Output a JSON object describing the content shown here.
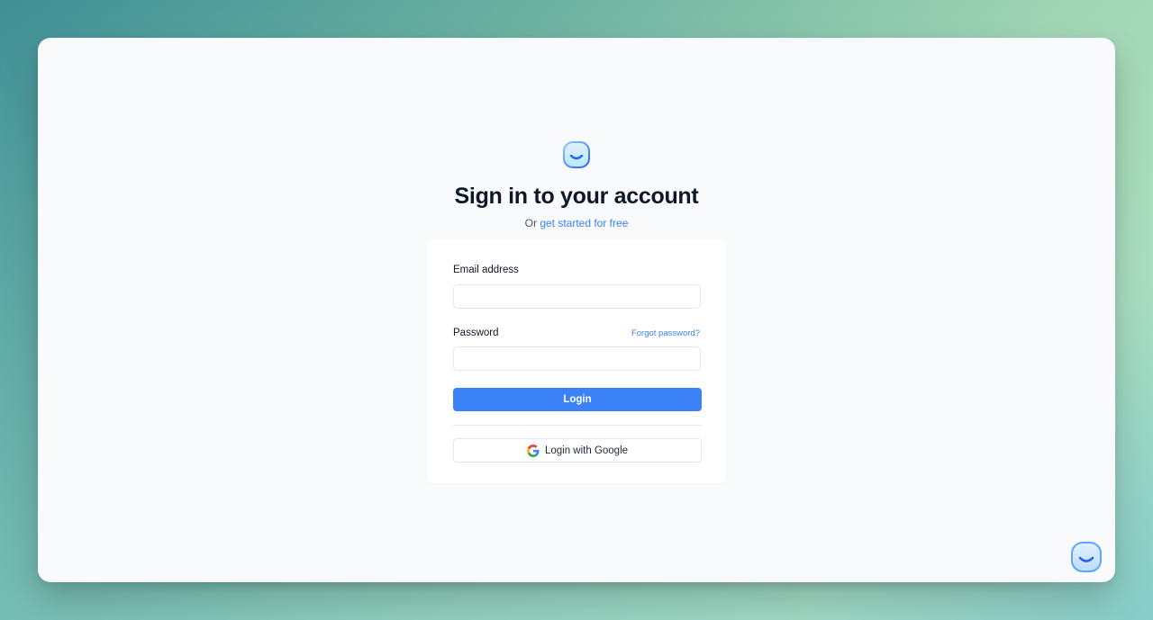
{
  "app": {
    "logo_icon": "smiley-face-logo-icon",
    "chat_widget_icon": "smiley-chat-widget-icon"
  },
  "header": {
    "title": "Sign in to your account",
    "subtitle_prefix": "Or",
    "subtitle_link": "get started for free"
  },
  "form": {
    "email_label": "Email address",
    "email_value": "",
    "email_placeholder": "",
    "password_label": "Password",
    "password_value": "",
    "password_placeholder": "",
    "forgot_password": "Forgot password?",
    "login_label": "Login",
    "google_login_label": "Login with Google",
    "google_icon": "google-g-icon"
  },
  "colors": {
    "accent": "#3b82f6",
    "title": "#0f172a",
    "window_bg": "#f8fafc",
    "card_bg": "#ffffff"
  }
}
